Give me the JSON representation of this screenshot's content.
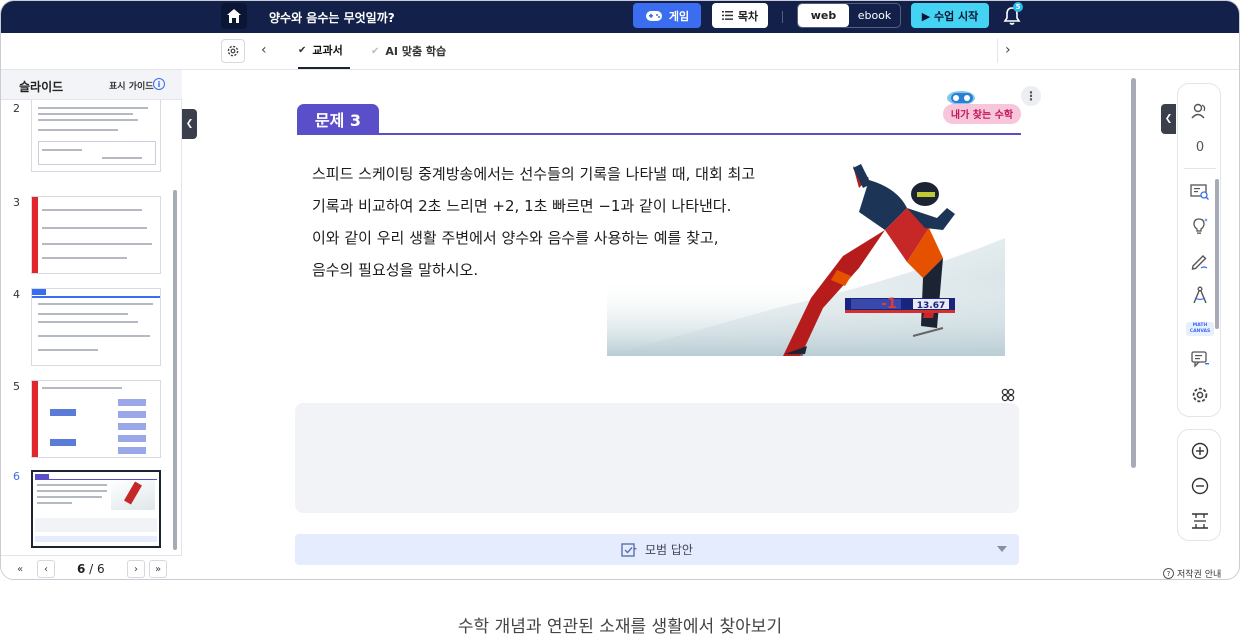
{
  "topbar": {
    "lesson_title": "양수와 음수는 무엇일까?",
    "game_label": "게임",
    "toc_label": "목차",
    "mode_web": "web",
    "mode_ebook": "ebook",
    "start_label": "▶ 수업 시작",
    "notification_count": "5"
  },
  "tabs": {
    "textbook": "교과서",
    "ai_learning": "AI 맞춤 학습"
  },
  "sidebar": {
    "title": "슬라이드",
    "guide_label": "표시 가이드",
    "slides": [
      {
        "num": "2"
      },
      {
        "num": "3"
      },
      {
        "num": "4"
      },
      {
        "num": "5"
      },
      {
        "num": "6"
      }
    ],
    "current_page": "6",
    "total_pages": "6",
    "page_sep": " / "
  },
  "problem": {
    "tag": "문제 3",
    "sticker_text": "내가 찾는 수학",
    "lines": [
      "스피드 스케이팅 중계방송에서는 선수들의 기록을  나타낼 때, 대회 최고",
      "기록과 비교하여 2초 느리면 +2, 1초 빠르면 −1과 같이 나타낸다.",
      "이와 같이 우리 생활 주변에서 양수와 음수를 사용하는 예를 찾고,",
      "음수의 필요성을 말하시오."
    ],
    "scoreboard_delta": "-1",
    "scoreboard_time": "13.67",
    "model_answer_label": "모범 답안"
  },
  "tools": {
    "user_count": "0",
    "canvas_chip": "MATH CANVAS"
  },
  "footer": {
    "copyright": "저작권 안내",
    "caption": "수학 개념과 연관된 소재를 생활에서 찾아보기"
  },
  "colors": {
    "topbar": "#13214a",
    "accent_blue": "#3a6df0",
    "start_cyan": "#44d3f2",
    "problem_purple": "#5b4fc9",
    "answer_bg": "#e5ecfd"
  }
}
